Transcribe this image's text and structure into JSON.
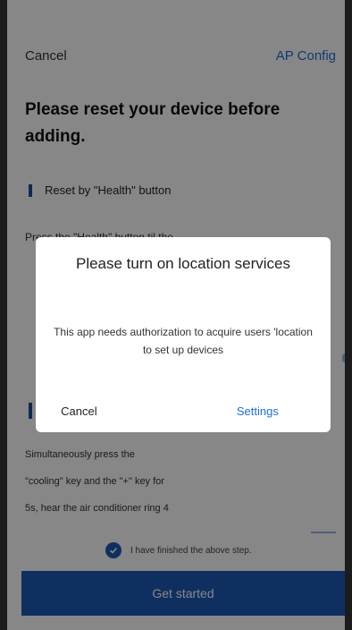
{
  "nav": {
    "cancel": "Cancel",
    "right": "AP Config"
  },
  "title": "Please reset your device before adding.",
  "section1": {
    "heading": "Reset by \"Health\" button"
  },
  "instructions": [
    "Press the \"Health\" button til the",
    "",
    "",
    "",
    ""
  ],
  "section2_lines": [
    "Simultaneously press the",
    "\"cooling\" key and the \"+\" key for",
    "5s, hear the air conditioner ring 4"
  ],
  "confirm_label": "I have finished the above step.",
  "get_started": "Get started",
  "dialog": {
    "title": "Please turn on location services",
    "message": "This app needs authorization to acquire users 'location to set up devices",
    "cancel": "Cancel",
    "settings": "Settings"
  },
  "colors": {
    "accent": "#1f5ab8",
    "link": "#1f6fd6"
  }
}
